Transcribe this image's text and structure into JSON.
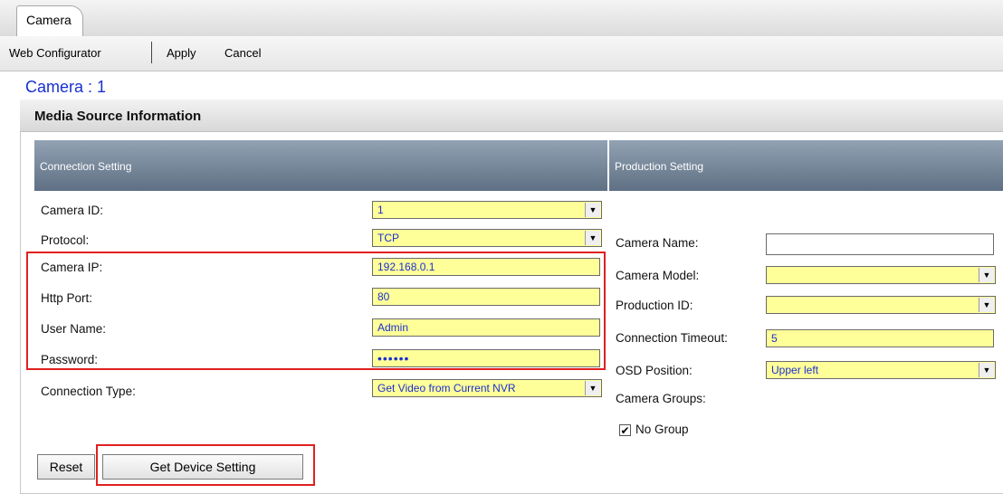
{
  "tab": {
    "label": "Camera"
  },
  "toolbar": {
    "web_configurator": "Web Configurator",
    "apply": "Apply",
    "cancel": "Cancel"
  },
  "page": {
    "title": "Camera : 1"
  },
  "panel": {
    "title": "Media Source Information"
  },
  "connection": {
    "header": "Connection Setting",
    "camera_id": {
      "label": "Camera ID:",
      "value": "1"
    },
    "protocol": {
      "label": "Protocol:",
      "value": "TCP"
    },
    "camera_ip": {
      "label": "Camera IP:",
      "value": "192.168.0.1"
    },
    "http_port": {
      "label": "Http Port:",
      "value": "80"
    },
    "user_name": {
      "label": "User Name:",
      "value": "Admin"
    },
    "password": {
      "label": "Password:",
      "value": "••••••"
    },
    "connection_type": {
      "label": "Connection Type:",
      "value": "Get Video from Current NVR"
    }
  },
  "production": {
    "header": "Production Setting",
    "camera_name": {
      "label": "Camera Name:",
      "value": ""
    },
    "camera_model": {
      "label": "Camera Model:",
      "value": ""
    },
    "production_id": {
      "label": "Production ID:",
      "value": ""
    },
    "connection_timeout": {
      "label": "Connection Timeout:",
      "value": "5"
    },
    "osd_position": {
      "label": "OSD Position:",
      "value": "Upper left"
    },
    "camera_groups": {
      "label": "Camera Groups:"
    },
    "no_group": {
      "label": "No Group",
      "checked": true
    }
  },
  "buttons": {
    "reset": "Reset",
    "get_device_setting": "Get Device Setting"
  },
  "icons": {
    "dropdown": "chevron-down-icon",
    "check": "checkmark-icon"
  },
  "colors": {
    "field_bg": "#ffff99",
    "title_blue": "#1730d0",
    "highlight_red": "#e02020",
    "header_blue": "#6b7c90"
  }
}
